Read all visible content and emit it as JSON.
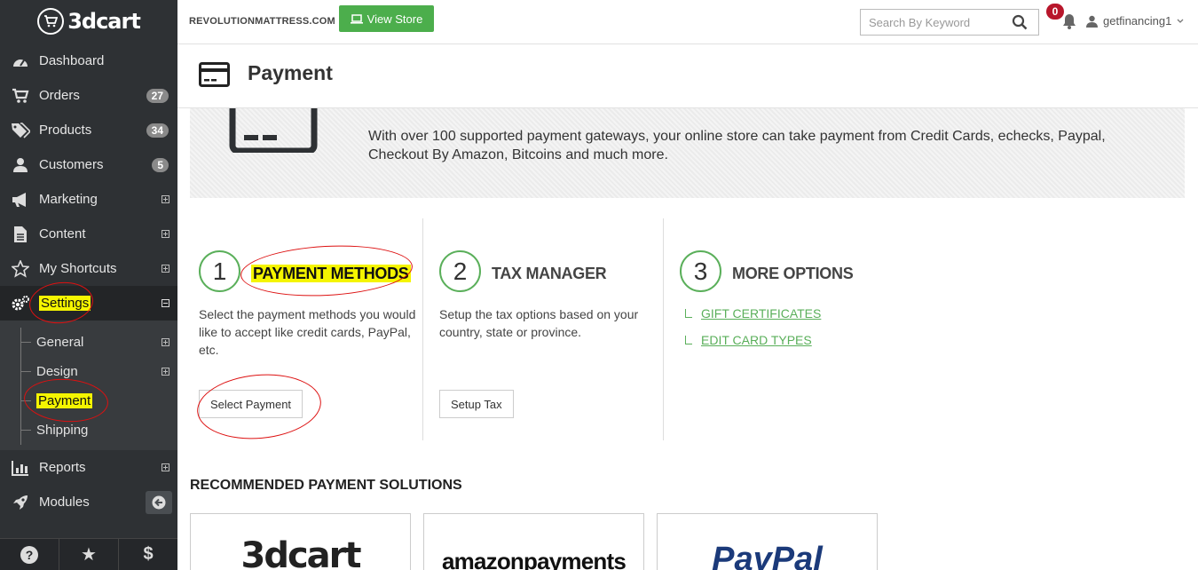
{
  "brand": {
    "logo_text": "3dcart"
  },
  "sidebar": {
    "items": [
      {
        "label": "Dashboard",
        "icon": "dashboard-icon"
      },
      {
        "label": "Orders",
        "icon": "cart-icon",
        "badge": "27"
      },
      {
        "label": "Products",
        "icon": "tags-icon",
        "badge": "34"
      },
      {
        "label": "Customers",
        "icon": "user-icon",
        "badge": "5"
      },
      {
        "label": "Marketing",
        "icon": "bullhorn-icon"
      },
      {
        "label": "Content",
        "icon": "document-icon"
      },
      {
        "label": "My Shortcuts",
        "icon": "star-icon"
      },
      {
        "label": "Settings",
        "icon": "gears-icon"
      },
      {
        "label": "Reports",
        "icon": "chart-icon"
      },
      {
        "label": "Modules",
        "icon": "rocket-icon"
      }
    ],
    "settings_sub": [
      {
        "label": "General"
      },
      {
        "label": "Design"
      },
      {
        "label": "Payment"
      },
      {
        "label": "Shipping"
      }
    ],
    "footer": {
      "help": "?",
      "favorites": "★",
      "billing": "$"
    }
  },
  "topbar": {
    "store_name": "REVOLUTIONMATTRESS.COM",
    "view_store_label": "View Store",
    "search_placeholder": "Search By Keyword",
    "notifications_count": "0",
    "username": "getfinancing1"
  },
  "page": {
    "title": "Payment",
    "banner_text": "With over 100 supported payment gateways, your online store can take payment from Credit Cards, echecks, Paypal, Checkout By Amazon, Bitcoins and much more."
  },
  "steps": [
    {
      "number": "1",
      "title": "PAYMENT METHODS",
      "desc": "Select the payment methods you would like to accept like credit cards, PayPal, etc.",
      "button": "Select Payment"
    },
    {
      "number": "2",
      "title": "TAX MANAGER",
      "desc": "Setup the tax options based on your country, state or province.",
      "button": "Setup Tax"
    },
    {
      "number": "3",
      "title": "MORE OPTIONS",
      "links": [
        "GIFT CERTIFICATES",
        "EDIT CARD TYPES"
      ]
    }
  ],
  "recommended": {
    "title": "RECOMMENDED PAYMENT SOLUTIONS",
    "providers": [
      "3dcart",
      "amazonpayments",
      "PayPal"
    ]
  },
  "colors": {
    "accent_green": "#5aaf5a",
    "sidebar_bg": "#2e3134",
    "notify_red": "#b8162b",
    "annotation_red": "#d11111",
    "highlight": "#f5f500"
  }
}
